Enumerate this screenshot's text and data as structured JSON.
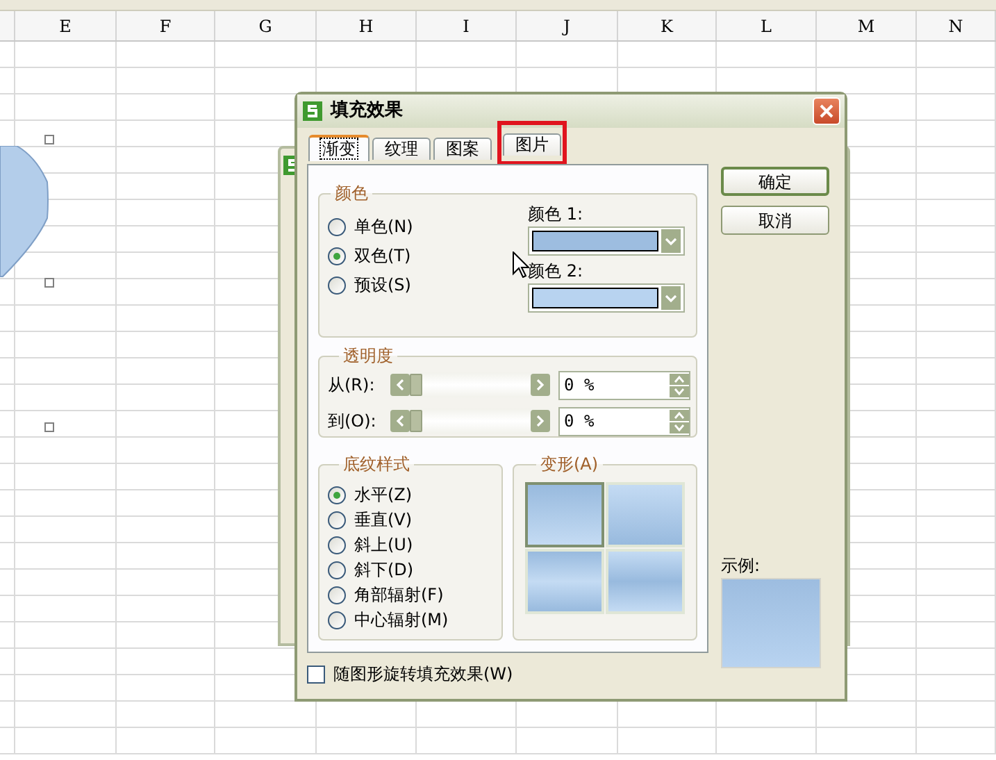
{
  "spreadsheet": {
    "columns": [
      "E",
      "F",
      "G",
      "H",
      "I",
      "J",
      "K",
      "L",
      "M",
      "N"
    ]
  },
  "dialog": {
    "title": "填充效果",
    "tabs": [
      {
        "label": "渐变",
        "selected": true,
        "highlighted": false
      },
      {
        "label": "纹理",
        "selected": false,
        "highlighted": false
      },
      {
        "label": "图案",
        "selected": false,
        "highlighted": false
      },
      {
        "label": "图片",
        "selected": false,
        "highlighted": true
      }
    ],
    "color_group": {
      "legend": "颜色",
      "options": [
        {
          "label": "单色(N)",
          "selected": false
        },
        {
          "label": "双色(T)",
          "selected": true
        },
        {
          "label": "预设(S)",
          "selected": false
        }
      ],
      "pickers": [
        {
          "label": "颜色 1:",
          "color": "#9dbde0"
        },
        {
          "label": "颜色 2:",
          "color": "#b8d3f0"
        }
      ]
    },
    "transparency_group": {
      "legend": "透明度",
      "rows": [
        {
          "label": "从(R):",
          "level": 0,
          "value": "0 %"
        },
        {
          "label": "到(O):",
          "level": 0,
          "value": "0 %"
        }
      ]
    },
    "shading_group": {
      "legend": "底纹样式",
      "options": [
        {
          "label": "水平(Z)",
          "selected": true
        },
        {
          "label": "垂直(V)",
          "selected": false
        },
        {
          "label": "斜上(U)",
          "selected": false
        },
        {
          "label": "斜下(D)",
          "selected": false
        },
        {
          "label": "角部辐射(F)",
          "selected": false
        },
        {
          "label": "中心辐射(M)",
          "selected": false
        }
      ]
    },
    "variants_group": {
      "legend": "变形(A)",
      "variants": [
        {
          "selected": true
        },
        {
          "selected": false
        },
        {
          "selected": false
        },
        {
          "selected": false
        }
      ]
    },
    "buttons": [
      "确定",
      "取消"
    ],
    "sample_label": "示例:",
    "rotate_checkbox": {
      "label": "随图形旋转填充效果(W)",
      "checked": false
    }
  }
}
